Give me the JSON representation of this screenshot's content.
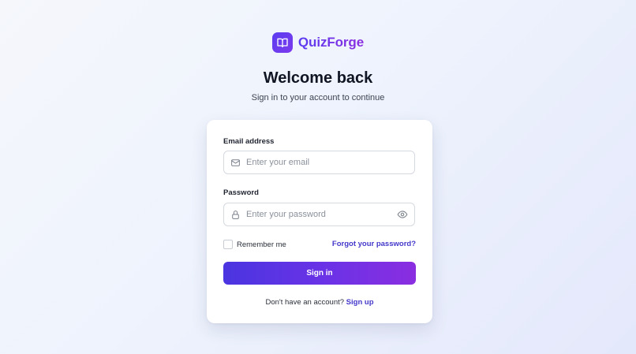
{
  "brand": {
    "name": "QuizForge",
    "logo_icon": "open-book-icon",
    "colors": {
      "start": "#5b3df0",
      "end": "#8b2fe0"
    }
  },
  "header": {
    "title": "Welcome back",
    "subtitle": "Sign in to your account to continue"
  },
  "form": {
    "email": {
      "label": "Email address",
      "placeholder": "Enter your email",
      "value": "",
      "icon": "mail-icon"
    },
    "password": {
      "label": "Password",
      "placeholder": "Enter your password",
      "value": "",
      "icon": "lock-icon",
      "toggle_icon": "eye-icon"
    },
    "remember_label": "Remember me",
    "remember_checked": false,
    "forgot_label": "Forgot your password?",
    "submit_label": "Sign in",
    "signup_prompt": "Don't have an account?",
    "signup_label": "Sign up"
  },
  "colors": {
    "accent": "#4338ca",
    "button_start": "#4a35e0",
    "button_end": "#8a2ee0"
  }
}
